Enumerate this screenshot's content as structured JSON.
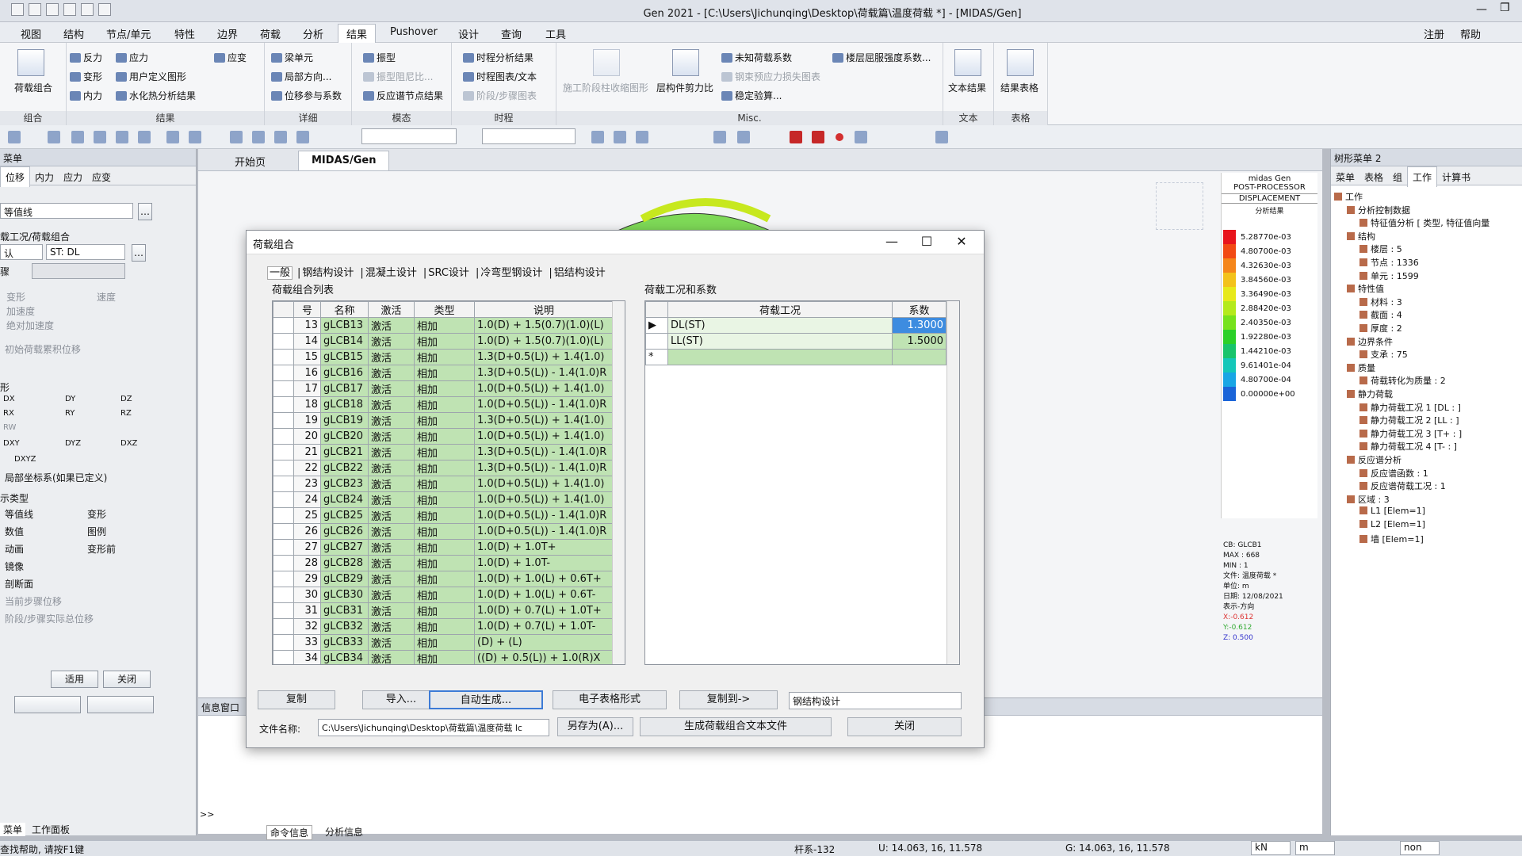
{
  "window": {
    "title": "Gen 2021 - [C:\\Users\\Jichunqing\\Desktop\\荷载篇\\温度荷载 *] - [MIDAS/Gen]"
  },
  "menu": {
    "items": [
      "视图",
      "结构",
      "节点/单元",
      "特性",
      "边界",
      "荷载",
      "分析",
      "结果",
      "Pushover",
      "设计",
      "查询",
      "工具"
    ],
    "right": [
      "注册",
      "帮助"
    ]
  },
  "ribbon": {
    "groups": [
      "组合",
      "结果",
      "详细",
      "模态",
      "时程",
      "Misc.",
      "文本",
      "表格"
    ],
    "g_combo": {
      "item": "荷载组合"
    },
    "g_result": {
      "items": [
        "反力",
        "应力",
        "应变",
        "变形",
        "用户定义图形",
        "内力",
        "水化热分析结果"
      ]
    },
    "g_detail": {
      "items": [
        "梁单元",
        "局部方向...",
        "位移参与系数"
      ]
    },
    "g_modal": {
      "items": [
        "振型",
        "振型阻尼比...",
        "反应谱节点结果"
      ]
    },
    "g_th": {
      "items": [
        "时程分析结果",
        "时程图表/文本",
        "阶段/步骤图表"
      ]
    },
    "g_misc": {
      "items": [
        "施工阶段柱收缩图形",
        "层构件剪力比",
        "未知荷载系数",
        "钢束预应力损失图表",
        "稳定验算...",
        "楼层屈服强度系数..."
      ]
    },
    "g_text": {
      "item": "文本结果"
    },
    "g_table": {
      "item": "结果表格"
    }
  },
  "left_panel": {
    "header": "菜单",
    "tabs": [
      "位移",
      "内力",
      "应力",
      "应变"
    ],
    "contour_select": "等值线",
    "combo_label": "载工况/荷载组合",
    "case_select_a": "认",
    "case_select_b": "ST: DL",
    "step_label": "骤",
    "opts": [
      "变形",
      "速度",
      "加速度",
      "绝对加速度"
    ],
    "init_check": "初始荷载累积位移",
    "shape_label": "形",
    "dirs": [
      "DX",
      "DY",
      "DZ",
      "RX",
      "RY",
      "RZ",
      "RW",
      "DXY",
      "DYZ",
      "DXZ",
      "DXYZ"
    ],
    "local_cs": "局部坐标系(如果已定义)",
    "display_type": "示类型",
    "disp_items": [
      "等值线",
      "变形",
      "数值",
      "图例",
      "动画",
      "变形前",
      "镜像",
      "剖断面"
    ],
    "step_opts": [
      "当前步骤位移",
      "阶段/步骤实际总位移"
    ],
    "apply": "适用",
    "close": "关闭",
    "bottom_tabs": [
      "菜单",
      "工作面板"
    ]
  },
  "doc_tabs": [
    "开始页",
    "MIDAS/Gen"
  ],
  "legend": {
    "title1": "midas Gen",
    "title2": "POST-PROCESSOR",
    "title3": "DISPLACEMENT",
    "title4": "分析结果",
    "values": [
      "5.28770e-03",
      "4.80700e-03",
      "4.32630e-03",
      "3.84560e-03",
      "3.36490e-03",
      "2.88420e-03",
      "2.40350e-03",
      "1.92280e-03",
      "1.44210e-03",
      "9.61401e-04",
      "4.80700e-04",
      "0.00000e+00"
    ],
    "colors": [
      "#e8141c",
      "#f24a14",
      "#f5861a",
      "#f3c21a",
      "#e7e91a",
      "#b4ea1c",
      "#76e21c",
      "#2bd028",
      "#18c46b",
      "#14c7b9",
      "#19a6e5",
      "#1a64d8"
    ],
    "info": [
      "CB: GLCB1",
      "MAX : 668",
      "MIN : 1",
      "文件: 温度荷载 *",
      "单位: m",
      "日期: 12/08/2021",
      "表示-方向"
    ],
    "axes": [
      "X:-0.612",
      "Y:-0.612",
      "Z: 0.500"
    ]
  },
  "right_panel": {
    "header": "树形菜单 2",
    "tabs": [
      "菜单",
      "表格",
      "组",
      "工作",
      "计算书"
    ],
    "tree": [
      "工作",
      "分析控制数据",
      "特征值分析 [ 类型, 特征值向量",
      "结构",
      "楼层 : 5",
      "节点 : 1336",
      "单元 : 1599",
      "特性值",
      "材料 : 3",
      "截面 : 4",
      "厚度 : 2",
      "边界条件",
      "支承 : 75",
      "质量",
      "荷载转化为质量 : 2",
      "静力荷载",
      "静力荷载工况 1 [DL : ]",
      "静力荷载工况 2 [LL : ]",
      "静力荷载工况 3 [T+ : ]",
      "静力荷载工况 4 [T- : ]",
      "反应谱分析",
      "反应谱函数 : 1",
      "反应谱荷载工况 : 1",
      "区域 : 3",
      "L1 [Elem=1]",
      "L2 [Elem=1]",
      "墙 [Elem=1]"
    ]
  },
  "msg": {
    "header": "信息窗口",
    "prompt": ">>",
    "tabs": [
      "命令信息",
      "分析信息"
    ]
  },
  "status": {
    "help": "查找帮助, 请按F1键",
    "elem": "杆系-132",
    "u": "U: 14.063, 16, 11.578",
    "g": "G: 14.063, 16, 11.578",
    "unit1": "kN",
    "unit2": "m",
    "none": "non"
  },
  "dialog": {
    "title": "荷载组合",
    "tabs": [
      "一般",
      "钢结构设计",
      "混凝土设计",
      "SRC设计",
      "冷弯型钢设计",
      "铝结构设计"
    ],
    "left_title": "荷载组合列表",
    "cols": [
      "号",
      "名称",
      "激活",
      "类型",
      "说明"
    ],
    "rows": [
      [
        "13",
        "gLCB13",
        "激活",
        "相加",
        "1.0(D) + 1.5(0.7)(1.0)(L)"
      ],
      [
        "14",
        "gLCB14",
        "激活",
        "相加",
        "1.0(D) + 1.5(0.7)(1.0)(L)"
      ],
      [
        "15",
        "gLCB15",
        "激活",
        "相加",
        "1.3(D+0.5(L)) + 1.4(1.0)"
      ],
      [
        "16",
        "gLCB16",
        "激活",
        "相加",
        "1.3(D+0.5(L)) - 1.4(1.0)R"
      ],
      [
        "17",
        "gLCB17",
        "激活",
        "相加",
        "1.0(D+0.5(L)) + 1.4(1.0)"
      ],
      [
        "18",
        "gLCB18",
        "激活",
        "相加",
        "1.0(D+0.5(L)) - 1.4(1.0)R"
      ],
      [
        "19",
        "gLCB19",
        "激活",
        "相加",
        "1.3(D+0.5(L)) + 1.4(1.0)"
      ],
      [
        "20",
        "gLCB20",
        "激活",
        "相加",
        "1.0(D+0.5(L)) + 1.4(1.0)"
      ],
      [
        "21",
        "gLCB21",
        "激活",
        "相加",
        "1.3(D+0.5(L)) - 1.4(1.0)R"
      ],
      [
        "22",
        "gLCB22",
        "激活",
        "相加",
        "1.3(D+0.5(L)) - 1.4(1.0)R"
      ],
      [
        "23",
        "gLCB23",
        "激活",
        "相加",
        "1.0(D+0.5(L)) + 1.4(1.0)"
      ],
      [
        "24",
        "gLCB24",
        "激活",
        "相加",
        "1.0(D+0.5(L)) + 1.4(1.0)"
      ],
      [
        "25",
        "gLCB25",
        "激活",
        "相加",
        "1.0(D+0.5(L)) - 1.4(1.0)R"
      ],
      [
        "26",
        "gLCB26",
        "激活",
        "相加",
        "1.0(D+0.5(L)) - 1.4(1.0)R"
      ],
      [
        "27",
        "gLCB27",
        "激活",
        "相加",
        "1.0(D) + 1.0T+"
      ],
      [
        "28",
        "gLCB28",
        "激活",
        "相加",
        "1.0(D) + 1.0T-"
      ],
      [
        "29",
        "gLCB29",
        "激活",
        "相加",
        "1.0(D) + 1.0(L) + 0.6T+"
      ],
      [
        "30",
        "gLCB30",
        "激活",
        "相加",
        "1.0(D) + 1.0(L) + 0.6T-"
      ],
      [
        "31",
        "gLCB31",
        "激活",
        "相加",
        "1.0(D) + 0.7(L) + 1.0T+"
      ],
      [
        "32",
        "gLCB32",
        "激活",
        "相加",
        "1.0(D) + 0.7(L) + 1.0T-"
      ],
      [
        "33",
        "gLCB33",
        "激活",
        "相加",
        "(D) + (L)"
      ],
      [
        "34",
        "gLCB34",
        "激活",
        "相加",
        "((D) + 0.5(L)) + 1.0(R)X"
      ]
    ],
    "right_title": "荷载工况和系数",
    "rcols": [
      "荷载工况",
      "系数"
    ],
    "rrows": [
      [
        "DL(ST)",
        "1.3000"
      ],
      [
        "LL(ST)",
        "1.5000"
      ]
    ],
    "buttons": {
      "copy": "复制",
      "import": "导入...",
      "auto": "自动生成...",
      "excel": "电子表格形式",
      "copyto": "复制到->",
      "design": "钢结构设计",
      "file_label": "文件名称:",
      "file": "C:\\Users\\Jichunqing\\Desktop\\荷载篇\\温度荷载 lc",
      "saveas": "另存为(A)...",
      "gen": "生成荷载组合文本文件",
      "close": "关闭"
    }
  }
}
